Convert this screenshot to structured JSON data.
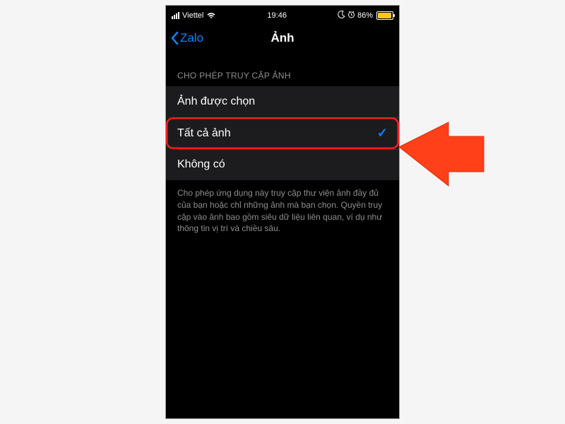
{
  "statusBar": {
    "carrier": "Viettel",
    "time": "19:46",
    "batteryPercent": "86%"
  },
  "nav": {
    "backLabel": "Zalo",
    "title": "Ảnh"
  },
  "section": {
    "header": "CHO PHÉP TRUY CẬP ẢNH"
  },
  "options": [
    {
      "label": "Ảnh được chọn",
      "checked": false
    },
    {
      "label": "Tất cả ảnh",
      "checked": true
    },
    {
      "label": "Không có",
      "checked": false
    }
  ],
  "footer": {
    "text": "Cho phép ứng dụng này truy cập thư viện ảnh đầy đủ của bạn hoặc chỉ những ảnh mà bạn chọn. Quyền truy cập vào ảnh bao gồm siêu dữ liệu liên quan, ví dụ như thông tin vị trí và chiều sâu."
  },
  "colors": {
    "accent": "#0a84ff",
    "highlight": "#ff1a1a",
    "arrow": "#ff4019"
  }
}
